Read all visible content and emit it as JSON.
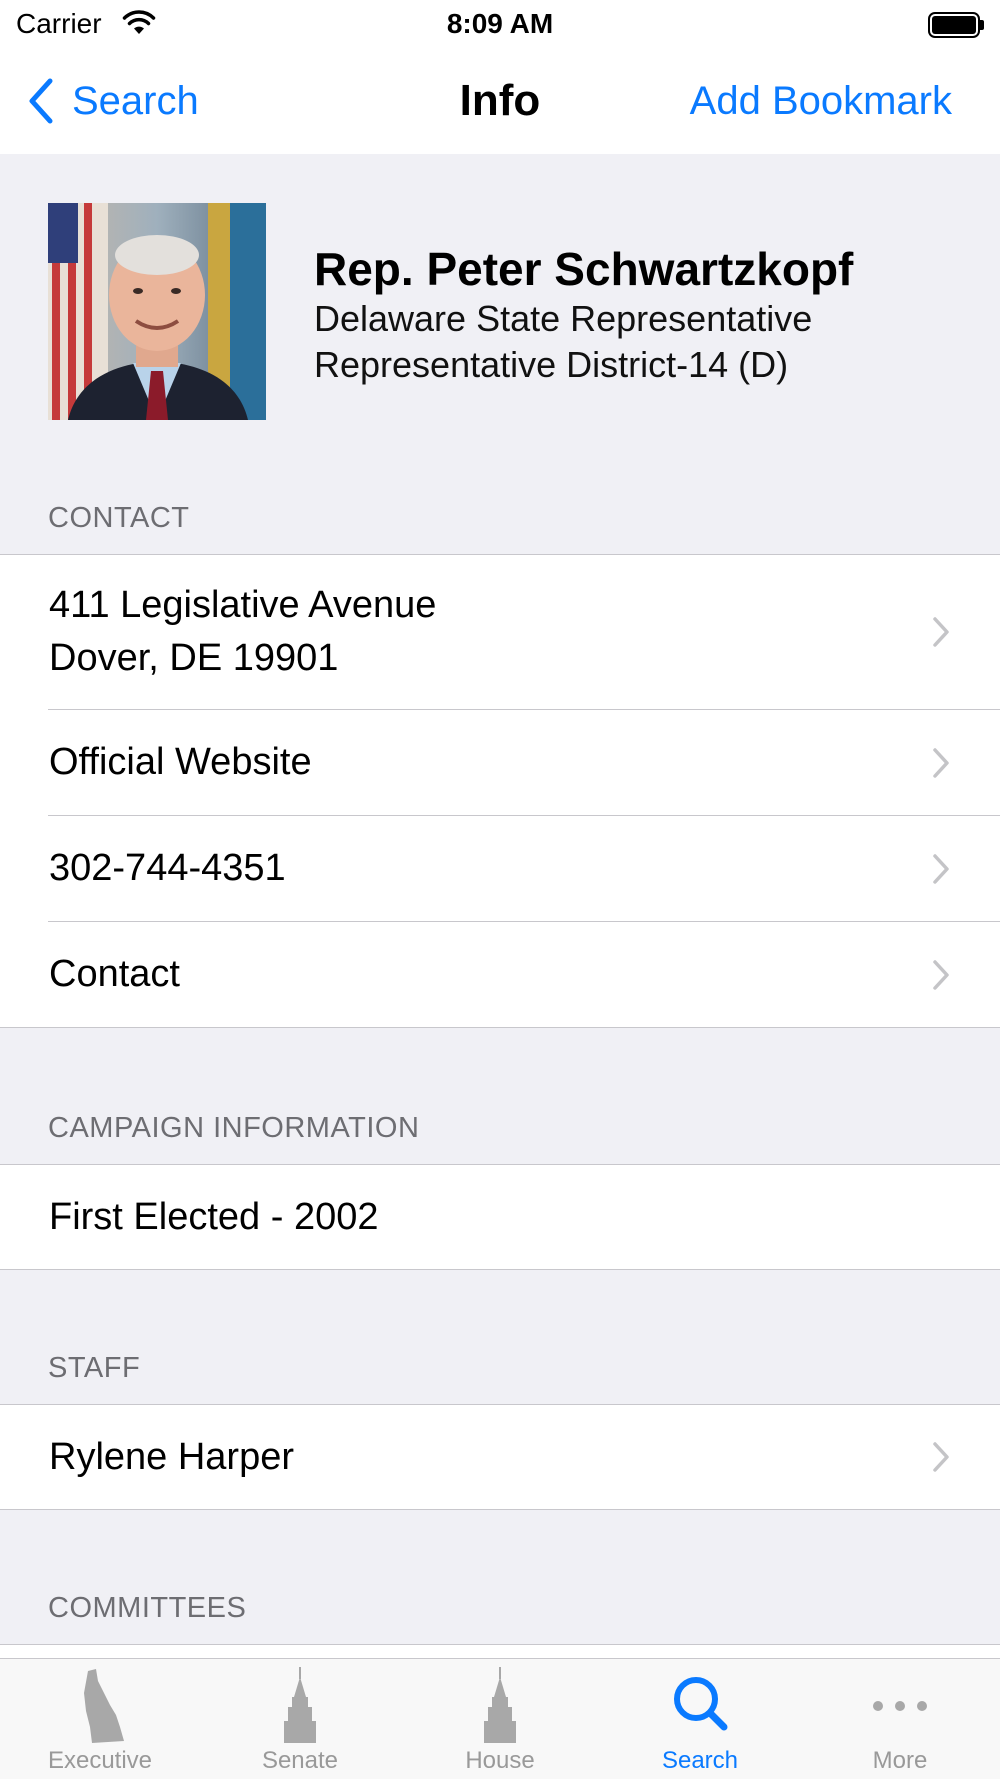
{
  "status_bar": {
    "carrier": "Carrier",
    "time": "8:09 AM",
    "battery_level": 1.0
  },
  "nav": {
    "back_label": "Search",
    "title": "Info",
    "action_label": "Add Bookmark"
  },
  "profile": {
    "name": "Rep. Peter Schwartzkopf",
    "line1": "Delaware State Representative",
    "line2": "Representative District-14 (D)"
  },
  "sections": {
    "contact": {
      "header": "CONTACT",
      "address_line1": "411 Legislative Avenue",
      "address_line2": "Dover, DE 19901",
      "website": "Official Website",
      "phone": "302-744-4351",
      "contact": "Contact"
    },
    "campaign": {
      "header": "CAMPAIGN INFORMATION",
      "first_elected": "First Elected - 2002"
    },
    "staff": {
      "header": "STAFF",
      "member": "Rylene Harper"
    },
    "committees": {
      "header": "COMMITTEES"
    }
  },
  "tabs": [
    {
      "label": "Executive",
      "icon": "delaware-state-icon",
      "active": false
    },
    {
      "label": "Senate",
      "icon": "capitol-tower-icon",
      "active": false
    },
    {
      "label": "House",
      "icon": "capitol-tower-icon",
      "active": false
    },
    {
      "label": "Search",
      "icon": "search-icon",
      "active": true
    },
    {
      "label": "More",
      "icon": "more-icon",
      "active": false
    }
  ],
  "colors": {
    "accent": "#0a7aff",
    "background": "#f0f0f5",
    "separator": "#c8c7cc",
    "section_header": "#6d6d72"
  }
}
